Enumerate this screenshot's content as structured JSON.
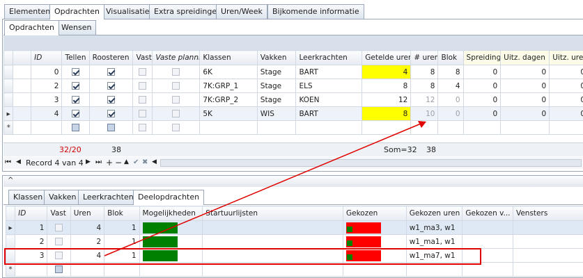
{
  "main_tabs": [
    "Elementen",
    "Opdrachten",
    "Visualisatie",
    "Extra spreidingen",
    "Uren/Week",
    "Bijkomende informatie"
  ],
  "sub_tabs": [
    "Opdrachten",
    "Wensen"
  ],
  "top_grid": {
    "headers": [
      "ID",
      "Tellen",
      "Roosteren",
      "Vast",
      "Vaste planning",
      "Klassen",
      "Vakken",
      "Leerkrachten",
      "Getelde uren",
      "# uren",
      "Blok",
      "Spreiding",
      "Uitz. dagen",
      "Uitz. uren"
    ],
    "rows": [
      {
        "id": "0",
        "tellen": true,
        "roosteren": true,
        "klassen": "6K",
        "vakken": "Stage",
        "leerkrachten": "BART",
        "getelde": "4",
        "uren": "8",
        "blok": "8",
        "spreiding": "0",
        "uitz_dagen": "0",
        "uitz_uren": "0"
      },
      {
        "id": "2",
        "tellen": true,
        "roosteren": true,
        "klassen": "7K:GRP_1",
        "vakken": "Stage",
        "leerkrachten": "ELS",
        "getelde": "8",
        "uren": "8",
        "blok": "4",
        "spreiding": "0",
        "uitz_dagen": "0",
        "uitz_uren": "0"
      },
      {
        "id": "3",
        "tellen": true,
        "roosteren": true,
        "klassen": "7K:GRP_2",
        "vakken": "Stage",
        "leerkrachten": "KOEN",
        "getelde": "12",
        "uren": "12",
        "blok": "0",
        "spreiding": "0",
        "uitz_dagen": "0",
        "uitz_uren": "0"
      },
      {
        "id": "4",
        "tellen": true,
        "roosteren": true,
        "klassen": "5K",
        "vakken": "WIS",
        "leerkrachten": "BART",
        "getelde": "8",
        "uren": "10",
        "blok": "0",
        "spreiding": "0",
        "uitz_dagen": "0",
        "uitz_uren": "0"
      }
    ],
    "footer": {
      "tellen": "32/20",
      "roosteren": "38",
      "leerkrachten_sum": "Som=32",
      "uren_sum": "38"
    },
    "new_row_marker": "*",
    "current_row_marker": "▸"
  },
  "navigator": {
    "record_text": "Record 4 van 4",
    "buttons": [
      "⏮",
      "◀",
      "▶",
      "⏭",
      "⏭+",
      "+",
      "−",
      "▲",
      "✔",
      "✖",
      "◀"
    ]
  },
  "bottom_tabs": [
    "Klassen",
    "Vakken",
    "Leerkrachten",
    "Deelopdrachten"
  ],
  "bottom_grid": {
    "headers": [
      "ID",
      "Vast",
      "Uren",
      "Blok",
      "Mogelijkheden",
      "Startuurlijsten",
      "Gekozen",
      "Gekozen uren",
      "Gekozen v...",
      "Vensters"
    ],
    "rows": [
      {
        "id": "1",
        "uren": "4",
        "blok": "1",
        "gekozen_uren": "w1_ma3,  w1"
      },
      {
        "id": "2",
        "uren": "2",
        "blok": "1",
        "gekozen_uren": "w1_ma1,  w1"
      },
      {
        "id": "3",
        "uren": "4",
        "blok": "1",
        "gekozen_uren": "w1_ma7,  w1"
      }
    ]
  },
  "collapse_glyph": "^",
  "colors": {
    "highlight_yellow": "#ffff00",
    "annotation_red": "#e00000",
    "bar_green": "#008000",
    "bar_red": "#ff0000"
  }
}
